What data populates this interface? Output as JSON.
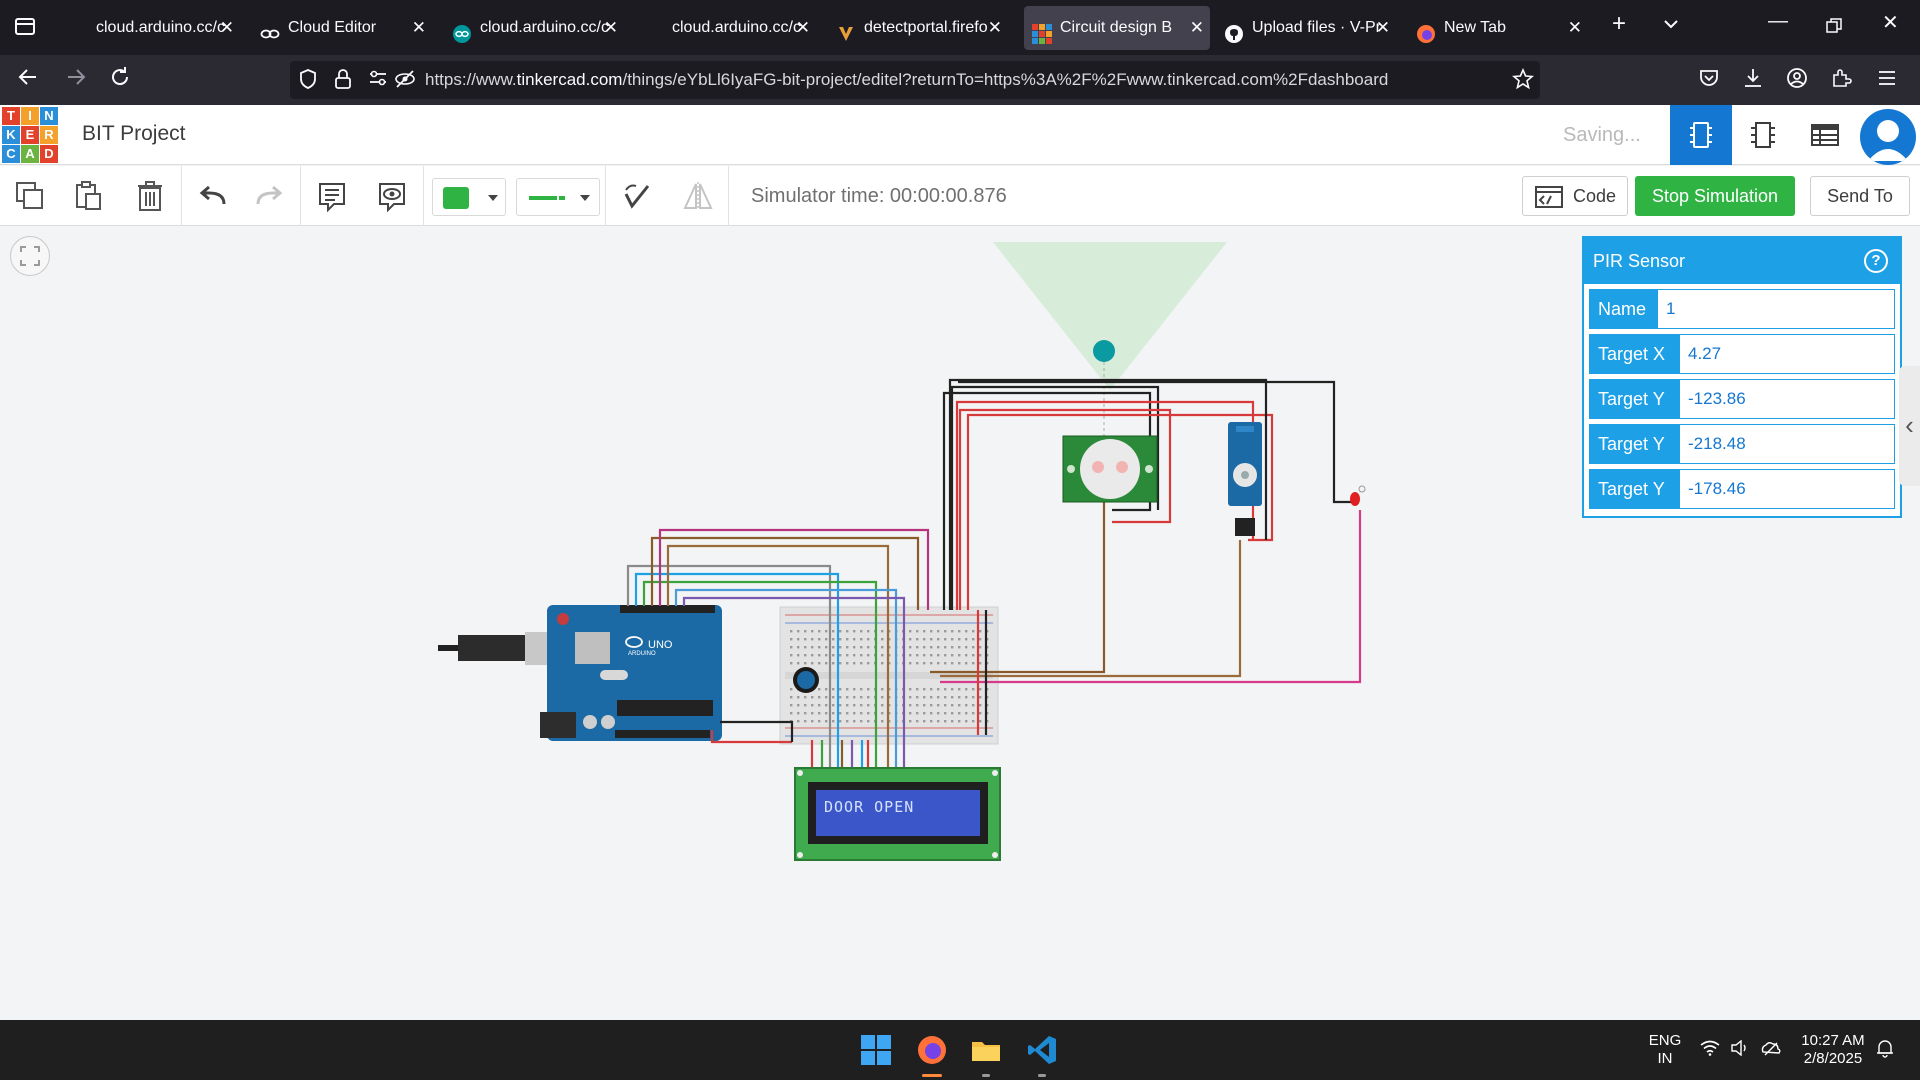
{
  "browser": {
    "tabs": [
      {
        "title": "cloud.arduino.cc/c",
        "icon": "blank-page-icon",
        "active": false
      },
      {
        "title": "Cloud Editor",
        "icon": "arduino-infinity-icon",
        "active": false
      },
      {
        "title": "cloud.arduino.cc/c",
        "icon": "arduino-teal-icon",
        "active": false
      },
      {
        "title": "cloud.arduino.cc/c",
        "icon": "blank-page-icon",
        "active": false
      },
      {
        "title": "detectportal.firefo",
        "icon": "firefox-portal-icon",
        "active": false
      },
      {
        "title": "Circuit design BIT",
        "icon": "tinkercad-icon",
        "active": true
      },
      {
        "title": "Upload files · V-Pr",
        "icon": "github-icon",
        "active": false
      },
      {
        "title": "New Tab",
        "icon": "firefox-icon",
        "active": false
      }
    ],
    "url": {
      "prefix": "https://www.",
      "domain": "tinkercad.com",
      "path": "/things/eYbLl6IyaFG-bit-project/editel?returnTo=https%3A%2F%2Fwww.tinkercad.com%2Fdashboard"
    }
  },
  "app": {
    "logo_letters": [
      "T",
      "I",
      "N",
      "K",
      "E",
      "R",
      "C",
      "A",
      "D"
    ],
    "logo_colors": [
      "#e2412b",
      "#f4a12c",
      "#2a8fd8",
      "#2a8fd8",
      "#e2412b",
      "#f4a12c",
      "#2a8fd8",
      "#6cb33f",
      "#e2412b"
    ],
    "project_title": "BIT Project",
    "status": "Saving...",
    "accent": "#1477d1"
  },
  "toolbar": {
    "simulator_time": "Simulator time: 00:00:00.876",
    "code_label": "Code",
    "stop_label": "Stop Simulation",
    "send_label": "Send To",
    "color_swatch": "#2fb343"
  },
  "circuit": {
    "lcd_text": "DOOR OPEN",
    "arduino_label": "UNO",
    "arduino_brand": "ARDUINO"
  },
  "inspector": {
    "title": "PIR Sensor",
    "help": "?",
    "rows": [
      {
        "label": "Name",
        "value": "1"
      },
      {
        "label": "Target X",
        "value": "4.27"
      },
      {
        "label": "Target Y",
        "value": "-123.86"
      },
      {
        "label": "Target Y",
        "value": "-218.48"
      },
      {
        "label": "Target Y",
        "value": "-178.46"
      }
    ]
  },
  "taskbar": {
    "lang_top": "ENG",
    "lang_bottom": "IN",
    "time": "10:27 AM",
    "date": "2/8/2025"
  }
}
